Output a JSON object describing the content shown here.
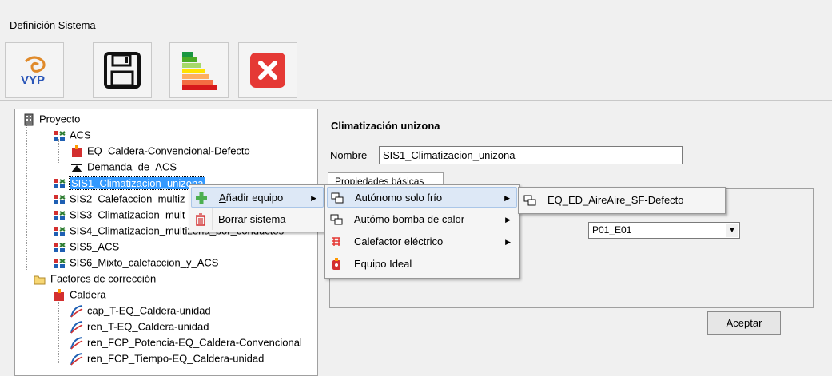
{
  "window": {
    "title": "Definición Sistema"
  },
  "toolbar": {
    "buttons": [
      {
        "icon": "vyp-logo-icon",
        "label": "VYP"
      },
      {
        "icon": "save-icon"
      },
      {
        "icon": "energy-rating-icon"
      },
      {
        "icon": "close-icon"
      }
    ]
  },
  "tree": {
    "root": "Proyecto",
    "acs": "ACS",
    "acs_children": [
      "EQ_Caldera-Convencional-Defecto",
      "Demanda_de_ACS"
    ],
    "systems": [
      "SIS1_Climatizacion_unizona",
      "SIS2_Calefaccion_multiz",
      "SIS3_Climatizacion_mult",
      "SIS4_Climatizacion_multizona_por_conductos",
      "SIS5_ACS",
      "SIS6_Mixto_calefaccion_y_ACS"
    ],
    "factors": "Factores de corrección",
    "caldera": "Caldera",
    "curves": [
      "cap_T-EQ_Caldera-unidad",
      "ren_T-EQ_Caldera-unidad",
      "ren_FCP_Potencia-EQ_Caldera-Convencional",
      "ren_FCP_Tiempo-EQ_Caldera-unidad"
    ]
  },
  "panel": {
    "title": "Climatización unizona",
    "name_label": "Nombre",
    "name_value": "SIS1_Climatizacion_unizona",
    "tab": "Propiedades básicas",
    "select_value": "P01_E01",
    "accept": "Aceptar"
  },
  "context_menu": {
    "items": [
      {
        "label": "Añadir equipo",
        "underline": "A",
        "rest": "ñadir equipo",
        "submenu": true
      },
      {
        "label": "Borrar sistema",
        "underline": "B",
        "rest": "orrar sistema",
        "submenu": false
      }
    ]
  },
  "submenu": {
    "items": [
      {
        "label": "Autónomo solo frío",
        "submenu": true
      },
      {
        "label": "Autómo bomba de calor",
        "submenu": true
      },
      {
        "label": "Calefactor eléctrico",
        "submenu": true
      },
      {
        "label": "Equipo Ideal",
        "submenu": false
      }
    ]
  },
  "submenu2": {
    "items": [
      "EQ_ED_AireAire_SF-Defecto"
    ]
  },
  "colors": {
    "selection": "#3399ff",
    "close_red": "#e53935",
    "menu_highlight": "#dde8f6"
  }
}
